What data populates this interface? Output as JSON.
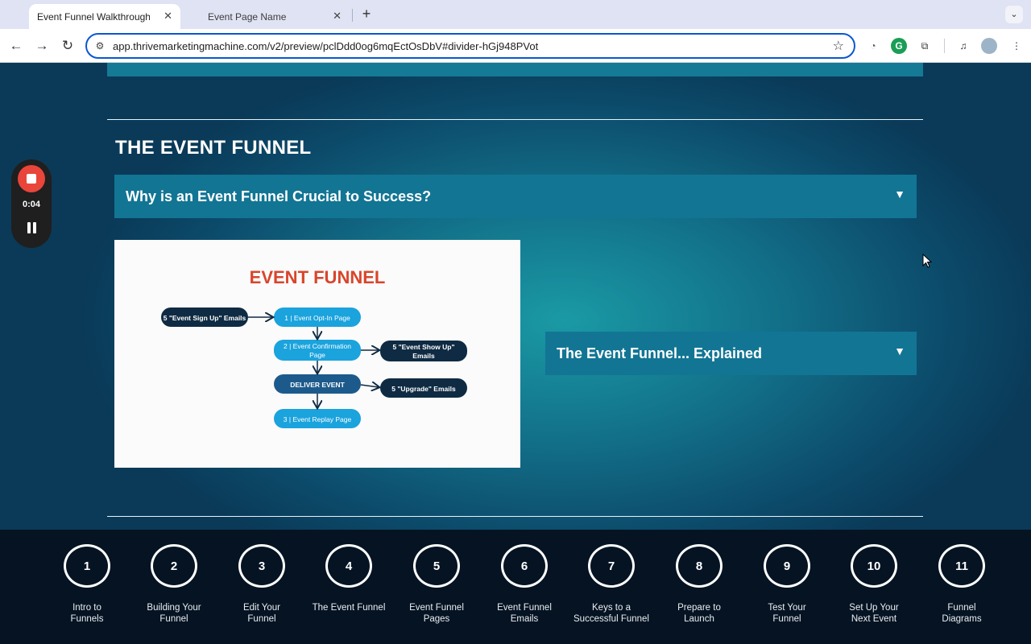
{
  "browser": {
    "tabs": [
      {
        "title": "Event Funnel Walkthrough (ST",
        "active": true
      },
      {
        "title": "Event Page Name",
        "active": false
      }
    ],
    "url": "app.thrivemarketingmachine.com/v2/preview/pclDdd0og6mqEctOsDbV#divider-hGj948PVot"
  },
  "recorder": {
    "time": "0:04"
  },
  "page": {
    "section_title": "THE EVENT FUNNEL",
    "accordion_1": "Why is an Event Funnel Crucial to Success?",
    "accordion_2": "The Event Funnel... Explained",
    "diagram": {
      "title": "EVENT FUNNEL",
      "signup_emails": "5 \"Event Sign Up\" Emails",
      "optin": "1 | Event Opt-In Page",
      "confirmation_1": "2 | Event Confirmation",
      "confirmation_2": "Page",
      "showup_1": "5 \"Event Show Up\"",
      "showup_2": "Emails",
      "deliver": "DELIVER EVENT",
      "upgrade": "5 \"Upgrade\" Emails",
      "replay": "3 | Event Replay Page"
    }
  },
  "steps": [
    {
      "num": "1",
      "l1": "Intro to",
      "l2": "Funnels"
    },
    {
      "num": "2",
      "l1": "Building Your",
      "l2": "Funnel"
    },
    {
      "num": "3",
      "l1": "Edit Your",
      "l2": "Funnel"
    },
    {
      "num": "4",
      "l1": "The Event Funnel",
      "l2": ""
    },
    {
      "num": "5",
      "l1": "Event Funnel",
      "l2": "Pages"
    },
    {
      "num": "6",
      "l1": "Event Funnel",
      "l2": "Emails"
    },
    {
      "num": "7",
      "l1": "Keys to a",
      "l2": "Successful Funnel"
    },
    {
      "num": "8",
      "l1": "Prepare to",
      "l2": "Launch"
    },
    {
      "num": "9",
      "l1": "Test Your",
      "l2": "Funnel"
    },
    {
      "num": "10",
      "l1": "Set Up Your",
      "l2": "Next Event"
    },
    {
      "num": "11",
      "l1": "Funnel",
      "l2": "Diagrams"
    }
  ],
  "colors": {
    "accent_orange": "#d9452b",
    "node_light": "#1aa3dd",
    "node_dark": "#0f2b43",
    "node_mid": "#1d5a8c",
    "accordion": "#127594"
  }
}
